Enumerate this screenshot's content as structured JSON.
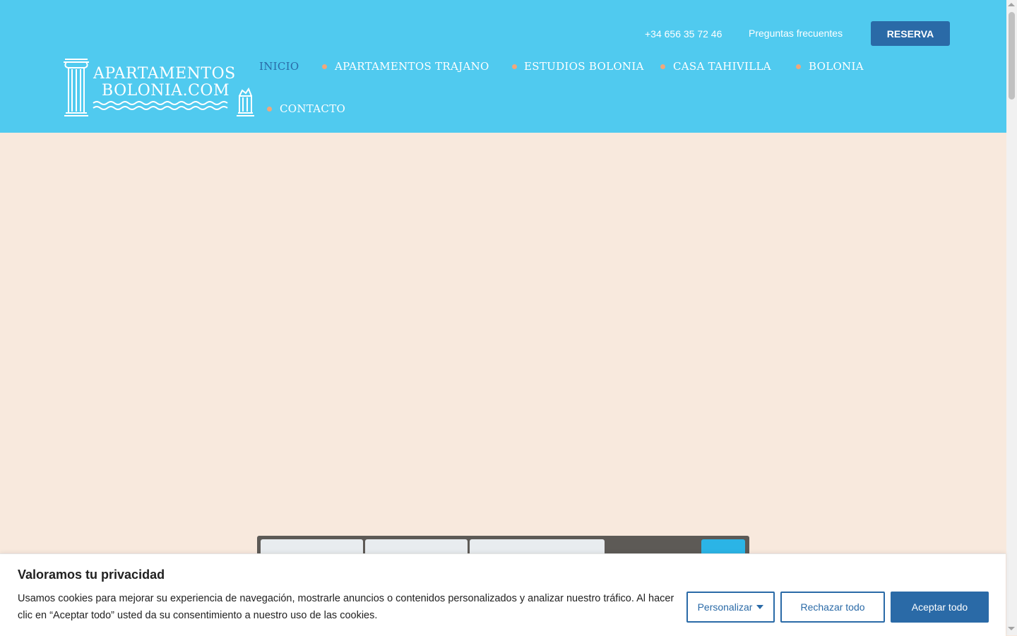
{
  "header": {
    "phone": "+34 656 35 72 46",
    "faq": "Preguntas frecuentes",
    "reserve": "RESERVA",
    "logo": {
      "line1": "APARTAMENTOS",
      "line2": "BOLONIA.COM"
    }
  },
  "nav": {
    "items": [
      {
        "label": "INICIO"
      },
      {
        "label": "APARTAMENTOS TRAJANO"
      },
      {
        "label": "ESTUDIOS BOLONIA"
      },
      {
        "label": "CASA TAHIVILLA"
      },
      {
        "label": "BOLONIA"
      },
      {
        "label": "CONTACTO"
      }
    ]
  },
  "cookie": {
    "title": "Valoramos tu privacidad",
    "text": "Usamos cookies para mejorar su experiencia de navegación, mostrarle anuncios o contenidos personalizados y analizar nuestro tráfico. Al hacer clic en “Aceptar todo” usted da su consentimiento a nuestro uso de las cookies.",
    "customize": "Personalizar",
    "reject": "Rechazar todo",
    "accept": "Aceptar todo"
  },
  "colors": {
    "header": "#50caef",
    "brand": "#2a6aa7",
    "accent_dot": "#f0a77b",
    "hero": "#f8e9dd"
  }
}
